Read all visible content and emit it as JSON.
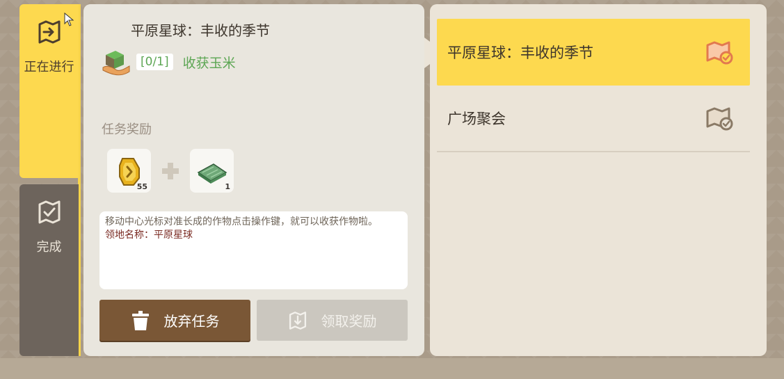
{
  "tabs": [
    {
      "label": "正在进行",
      "icon": "map-arrow-icon",
      "active": true
    },
    {
      "label": "完成",
      "icon": "map-check-icon",
      "active": false
    }
  ],
  "detail": {
    "title": "平原星球：丰收的季节",
    "objective": {
      "icon": "grass-block-hand-icon",
      "progress": "[0/1]",
      "text": "收获玉米"
    },
    "reward_title": "任务奖励",
    "rewards": [
      {
        "icon": "gold-coin-icon",
        "count": "55"
      },
      {
        "icon": "green-carpet-icon",
        "count": "1"
      }
    ],
    "description": "移动中心光标对准长成的作物点击操作键，就可以收获作物啦。",
    "territory": "领地名称：平原星球",
    "abandon_label": "放弃任务",
    "claim_label": "领取奖励"
  },
  "quests": [
    {
      "name": "平原星球：丰收的季节",
      "selected": true
    },
    {
      "name": "广场聚会",
      "selected": false
    }
  ],
  "colors": {
    "accent_yellow": "#fdd94f",
    "objective_green": "#5da654",
    "abandon_brown": "#7a5736",
    "territory_red": "#7a2a22"
  }
}
